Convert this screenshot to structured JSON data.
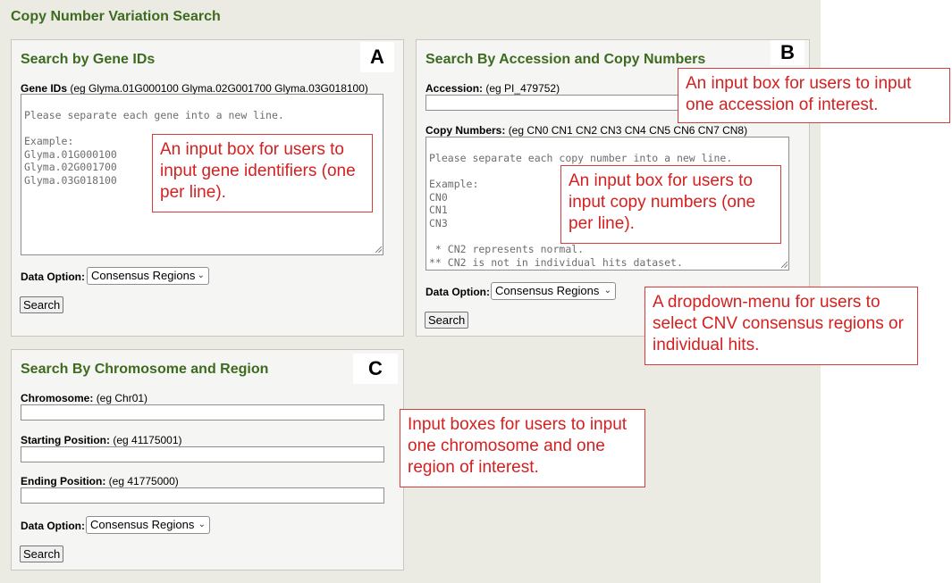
{
  "page": {
    "title": "Copy Number Variation Search"
  },
  "panel_a": {
    "letter": "A",
    "title": "Search by Gene IDs",
    "field_label": "Gene IDs",
    "field_hint": "(eg Glyma.01G000100 Glyma.02G001700 Glyma.03G018100)",
    "textarea_placeholder": "Please separate each gene into a new line.\n\nExample:\nGlyma.01G000100\nGlyma.02G001700\nGlyma.03G018100",
    "data_option_label": "Data Option:",
    "data_option_value": "Consensus Regions",
    "search_label": "Search"
  },
  "panel_b": {
    "letter": "B",
    "title": "Search By Accession and Copy Numbers",
    "accession_label": "Accession:",
    "accession_hint": "(eg PI_479752)",
    "copy_label": "Copy Numbers:",
    "copy_hint": "(eg CN0 CN1 CN2 CN3 CN4 CN5 CN6 CN7 CN8)",
    "textarea_placeholder": "Please separate each copy number into a new line.\n\nExample:\nCN0\nCN1\nCN3\n\n * CN2 represents normal.\n** CN2 is not in individual hits dataset.",
    "data_option_label": "Data Option:",
    "data_option_value": "Consensus Regions",
    "search_label": "Search"
  },
  "panel_c": {
    "letter": "C",
    "title": "Search By Chromosome and Region",
    "chromosome_label": "Chromosome:",
    "chromosome_hint": "(eg Chr01)",
    "start_label": "Starting Position:",
    "start_hint": "(eg 41175001)",
    "end_label": "Ending Position:",
    "end_hint": "(eg 41775000)",
    "data_option_label": "Data Option:",
    "data_option_value": "Consensus Regions",
    "search_label": "Search"
  },
  "callouts": {
    "gene_input": "An input box for users to input gene identifiers (one per line).",
    "accession_input": "An input box for users to input one accession of interest.",
    "copy_input": "An input box for users to input copy numbers (one per line).",
    "dropdown": "A dropdown-menu for users to select CNV consensus regions or individual hits.",
    "region_inputs": "Input boxes for users to input one chromosome and one region of interest."
  },
  "icons": {
    "dropdown": "chevron-down-icon",
    "resize": "resize-grip-icon"
  },
  "colors": {
    "heading_green": "#3d6b1f",
    "callout_red": "#d42020",
    "page_bg": "#ebebe4"
  }
}
